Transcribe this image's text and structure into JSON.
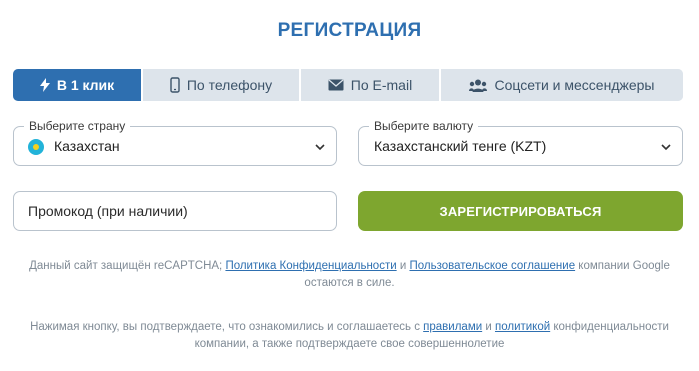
{
  "title": "РЕГИСТРАЦИЯ",
  "tabs": [
    {
      "label": "В 1 клик",
      "icon": "lightning-icon",
      "active": true
    },
    {
      "label": "По телефону",
      "icon": "phone-icon",
      "active": false
    },
    {
      "label": "По E-mail",
      "icon": "envelope-icon",
      "active": false
    },
    {
      "label": "Соцсети и мессенджеры",
      "icon": "users-icon",
      "active": false
    }
  ],
  "country": {
    "label": "Выберите страну",
    "value": "Казахстан",
    "flag": "kazakhstan-flag-icon"
  },
  "currency": {
    "label": "Выберите валюту",
    "value": "Казахстанский тенге (KZT)"
  },
  "promo": {
    "placeholder": "Промокод (при наличии)"
  },
  "submit": {
    "label": "ЗАРЕГИСТРИРОВАТЬСЯ"
  },
  "captcha": {
    "text1": "Данный сайт защищён reCAPTCHA; ",
    "link1": "Политика Конфиденциальности",
    "text2": " и ",
    "link2": "Пользовательское соглашение",
    "text3": " компании Google остаются в силе."
  },
  "terms": {
    "text1": "Нажимая кнопку, вы подтверждаете, что ознакомились и соглашаетесь с ",
    "link1": "правилами",
    "text2": " и ",
    "link2": "политикой",
    "text3": " конфиденциальности компании, а также подтверждаете свое совершеннолетие"
  },
  "colors": {
    "accent": "#2e6fb0",
    "submit": "#7ea62f",
    "tab_inactive": "#dde4eb",
    "muted_text": "#7f8a95"
  }
}
